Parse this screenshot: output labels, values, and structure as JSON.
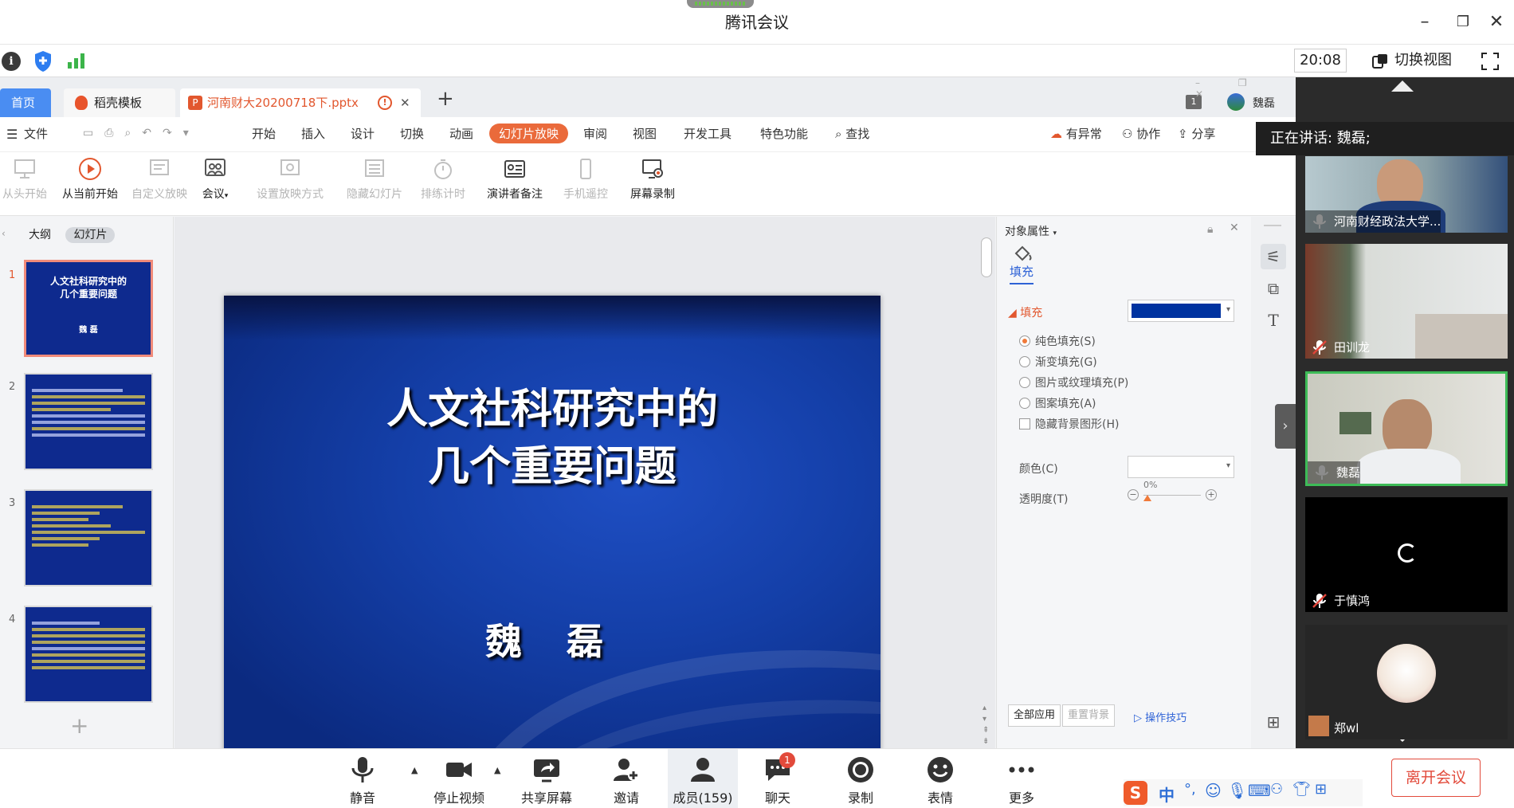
{
  "window": {
    "title": "腾讯会议"
  },
  "infobar": {
    "time": "20:08",
    "switch_view": "切换视图"
  },
  "wps": {
    "tabs": {
      "home": "首页",
      "template": "稻壳模板",
      "document": "河南财大20200718下.pptx"
    },
    "account": "魏磊",
    "notif_count": "1",
    "menu": {
      "file": "文件",
      "items": [
        "开始",
        "插入",
        "设计",
        "切换",
        "动画",
        "幻灯片放映",
        "审阅",
        "视图",
        "开发工具",
        "特色功能"
      ],
      "search": "查找",
      "sync": "有异常",
      "collab": "协作",
      "share": "分享"
    },
    "ribbon": [
      "从头开始",
      "从当前开始",
      "自定义放映",
      "会议",
      "设置放映方式",
      "隐藏幻灯片",
      "排练计时",
      "演讲者备注",
      "手机遥控",
      "屏幕录制"
    ],
    "leftpane": {
      "outline": "大纲",
      "slides": "幻灯片",
      "numbers": [
        "1",
        "2",
        "3",
        "4"
      ]
    },
    "slide": {
      "title_line1": "人文社科研究中的",
      "title_line2": "几个重要问题",
      "author": "魏 磊"
    },
    "props": {
      "header": "对象属性",
      "tab": "填充",
      "section": "填充",
      "fill_color": "#0033a0",
      "options": [
        "纯色填充(S)",
        "渐变填充(G)",
        "图片或纹理填充(P)",
        "图案填充(A)"
      ],
      "hide_bg": "隐藏背景图形(H)",
      "color_label": "颜色(C)",
      "transparency_label": "透明度(T)",
      "transparency_value": "0%",
      "apply_all": "全部应用",
      "reset_bg": "重置背景",
      "tips": "操作技巧"
    }
  },
  "video": {
    "speaking": "正在讲话: 魏磊;",
    "participants": [
      "河南财经政法大学...",
      "田训龙",
      "魏磊",
      "于慎鸿",
      "郑wl"
    ]
  },
  "toolbar": {
    "mute": "静音",
    "stop_video": "停止视频",
    "share_screen": "共享屏幕",
    "invite": "邀请",
    "members": "成员(159)",
    "chat": "聊天",
    "chat_badge": "1",
    "record": "录制",
    "emoji": "表情",
    "more": "更多",
    "leave": "离开会议",
    "ime_lang": "中"
  }
}
